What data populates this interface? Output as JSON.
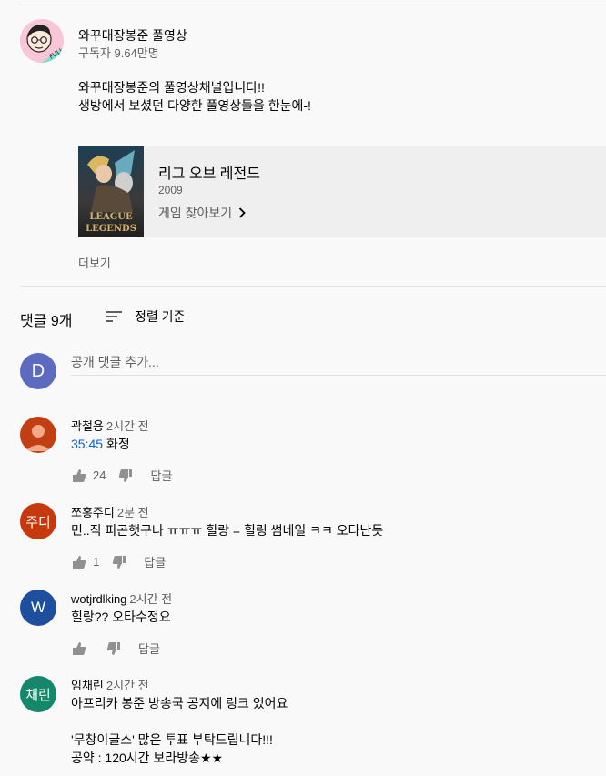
{
  "channel": {
    "name": "와꾸대장봉준 풀영상",
    "subscribers": "구독자 9.64만명",
    "avatar_badge": "FULL",
    "description": [
      "와꾸대장봉준의 풀영상채널입니다!!",
      "생방에서 보셨던 다양한 풀영상들을 한눈에-!"
    ]
  },
  "game": {
    "title": "리그 오브 레전드",
    "year": "2009",
    "link": "게임 찾아보기",
    "thumb_text": [
      "LEAGUE",
      "LEGENDS"
    ]
  },
  "more_label": "더보기",
  "comments_header": {
    "count": "댓글 9개",
    "sort": "정렬 기준"
  },
  "add_comment": {
    "avatar_letter": "D",
    "placeholder": "공개 댓글 추가..."
  },
  "comments": [
    {
      "author": "곽철용",
      "time": "2시간 전",
      "timestamp": "35:45",
      "text": " 화정",
      "likes": "24",
      "reply": "답글",
      "avatar_label": "",
      "avatar_color": "#c13f12"
    },
    {
      "author": "쪼홍주디",
      "time": "2분 전",
      "text": "민..직 피곤햇구나 ㅠㅠㅠ 힐랑 = 힐링 썸네일 ㅋㅋ 오타난듯",
      "likes": "1",
      "reply": "답글",
      "avatar_label": "주디",
      "avatar_color": "#c6380d"
    },
    {
      "author": "wotjrdlking",
      "time": "2시간 전",
      "text": "힐랑?? 오타수정요",
      "likes": "",
      "reply": "답글",
      "avatar_label": "W",
      "avatar_color": "#1e4f9e"
    },
    {
      "author": "임채린",
      "time": "2시간 전",
      "text_lines": [
        "아프리카 봉준 방송국 공지에 링크 있어요",
        "",
        "'무창이글스' 많은 투표 부탁드립니다!!!",
        "공약 : 120시간 보라방송★★"
      ],
      "avatar_label": "채린",
      "avatar_color": "#15876a"
    }
  ],
  "colors": {
    "link": "#065fd4",
    "secondary_text": "#606060",
    "divider": "#e0e0e0"
  }
}
